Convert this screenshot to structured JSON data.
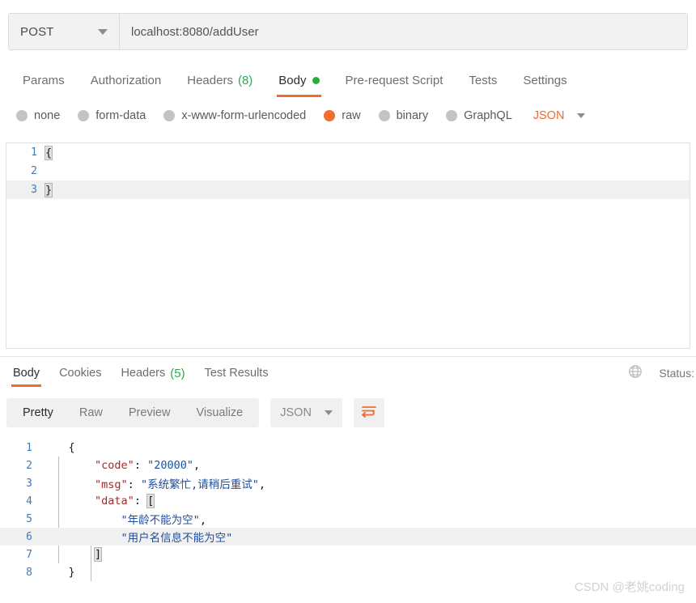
{
  "request": {
    "method": "POST",
    "url": "localhost:8080/addUser",
    "method_caret": "chevron-down",
    "tabs": [
      {
        "label": "Params",
        "active": false,
        "count": null,
        "dot": false
      },
      {
        "label": "Authorization",
        "active": false,
        "count": null,
        "dot": false
      },
      {
        "label": "Headers",
        "active": false,
        "count": "(8)",
        "dot": false
      },
      {
        "label": "Body",
        "active": true,
        "count": null,
        "dot": true
      },
      {
        "label": "Pre-request Script",
        "active": false,
        "count": null,
        "dot": false
      },
      {
        "label": "Tests",
        "active": false,
        "count": null,
        "dot": false
      },
      {
        "label": "Settings",
        "active": false,
        "count": null,
        "dot": false
      }
    ],
    "body_types": [
      {
        "label": "none",
        "selected": false
      },
      {
        "label": "form-data",
        "selected": false
      },
      {
        "label": "x-www-form-urlencoded",
        "selected": false
      },
      {
        "label": "raw",
        "selected": true
      },
      {
        "label": "binary",
        "selected": false
      },
      {
        "label": "GraphQL",
        "selected": false
      }
    ],
    "raw_format": "JSON",
    "editor_lines": [
      {
        "num": "1",
        "text": "{",
        "active": false,
        "bracket": true
      },
      {
        "num": "2",
        "text": "",
        "active": false,
        "bracket": false
      },
      {
        "num": "3",
        "text": "}",
        "active": true,
        "bracket": true
      }
    ]
  },
  "response": {
    "tabs": [
      {
        "label": "Body",
        "active": true,
        "count": null
      },
      {
        "label": "Cookies",
        "active": false,
        "count": null
      },
      {
        "label": "Headers",
        "active": false,
        "count": "(5)"
      },
      {
        "label": "Test Results",
        "active": false,
        "count": null
      }
    ],
    "status_label": "Status:",
    "globe_icon": "globe-icon",
    "view_modes": [
      {
        "label": "Pretty",
        "active": true
      },
      {
        "label": "Raw",
        "active": false
      },
      {
        "label": "Preview",
        "active": false
      },
      {
        "label": "Visualize",
        "active": false
      }
    ],
    "format": "JSON",
    "wrap_icon": "wrap-text-icon",
    "body_lines": [
      {
        "num": "1",
        "active": false,
        "tokens": [
          {
            "t": "    ",
            "c": "tok-punct"
          },
          {
            "t": "{",
            "c": "tok-brace"
          }
        ]
      },
      {
        "num": "2",
        "active": false,
        "tokens": [
          {
            "t": "        ",
            "c": "tok-punct"
          },
          {
            "t": "\"code\"",
            "c": "tok-key"
          },
          {
            "t": ": ",
            "c": "tok-punct"
          },
          {
            "t": "\"20000\"",
            "c": "tok-str"
          },
          {
            "t": ",",
            "c": "tok-punct"
          }
        ]
      },
      {
        "num": "3",
        "active": false,
        "tokens": [
          {
            "t": "        ",
            "c": "tok-punct"
          },
          {
            "t": "\"msg\"",
            "c": "tok-key"
          },
          {
            "t": ": ",
            "c": "tok-punct"
          },
          {
            "t": "\"系统繁忙,请稍后重试\"",
            "c": "tok-str"
          },
          {
            "t": ",",
            "c": "tok-punct"
          }
        ]
      },
      {
        "num": "4",
        "active": false,
        "tokens": [
          {
            "t": "        ",
            "c": "tok-punct"
          },
          {
            "t": "\"data\"",
            "c": "tok-key"
          },
          {
            "t": ": ",
            "c": "tok-punct"
          },
          {
            "t": "[",
            "c": "tok-brace bracket-hl"
          }
        ]
      },
      {
        "num": "5",
        "active": false,
        "tokens": [
          {
            "t": "            ",
            "c": "tok-punct"
          },
          {
            "t": "\"年龄不能为空\"",
            "c": "tok-str"
          },
          {
            "t": ",",
            "c": "tok-punct"
          }
        ]
      },
      {
        "num": "6",
        "active": true,
        "tokens": [
          {
            "t": "            ",
            "c": "tok-punct"
          },
          {
            "t": "\"用户名信息不能为空\"",
            "c": "tok-str"
          }
        ]
      },
      {
        "num": "7",
        "active": false,
        "tokens": [
          {
            "t": "        ",
            "c": "tok-punct"
          },
          {
            "t": "]",
            "c": "tok-brace bracket-hl"
          }
        ]
      },
      {
        "num": "8",
        "active": false,
        "tokens": [
          {
            "t": "    ",
            "c": "tok-punct"
          },
          {
            "t": "}",
            "c": "tok-brace"
          }
        ]
      }
    ]
  },
  "watermark": "CSDN @老姚coding",
  "colors": {
    "accent": "#ef6c2e",
    "green": "#27ae3c",
    "key": "#a52a2a",
    "string": "#1f4e9c",
    "linenum": "#3d7ab5"
  }
}
